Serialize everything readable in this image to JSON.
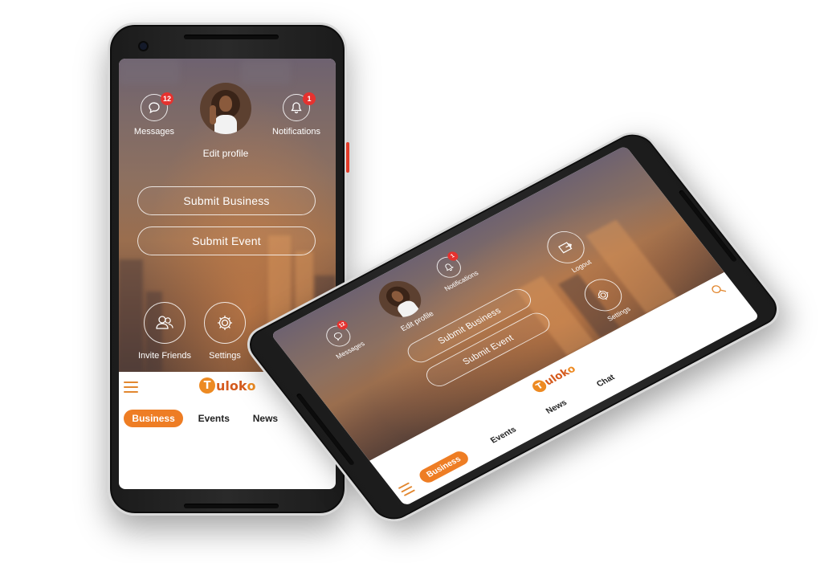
{
  "app": {
    "brand": {
      "prefix": "T",
      "middle": "ulok",
      "suffix": "o"
    },
    "brand_color": "#ee7d24",
    "badge_color": "#e5322f"
  },
  "header": {
    "messages": {
      "label": "Messages",
      "badge": "12",
      "icon": "chat-bubble-icon"
    },
    "notifications": {
      "label": "Notifications",
      "badge": "1",
      "icon": "bell-icon"
    },
    "profile": {
      "label": "Edit profile"
    }
  },
  "actions": {
    "submit_business": "Submit Business",
    "submit_event": "Submit Event"
  },
  "shortcuts": [
    {
      "label": "Invite Friends",
      "icon": "users-icon"
    },
    {
      "label": "Settings",
      "icon": "gear-icon"
    },
    {
      "label": "Logout",
      "icon": "logout-icon"
    }
  ],
  "tabs": [
    {
      "label": "Business",
      "active": true
    },
    {
      "label": "Events",
      "active": false
    },
    {
      "label": "News",
      "active": false
    },
    {
      "label": "Chat",
      "active": false
    }
  ]
}
